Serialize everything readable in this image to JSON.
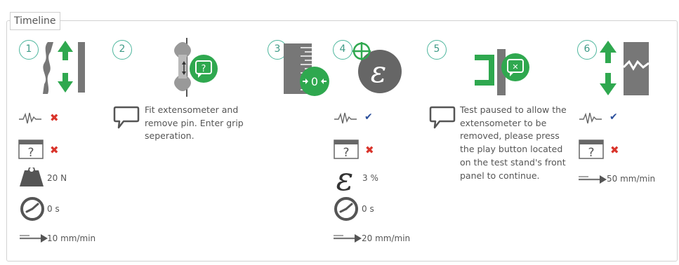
{
  "legend": "Timeline",
  "icons": {
    "data_capture": "waveform-icon",
    "prompt": "calendar-question-icon",
    "load": "weight-icon",
    "time": "clock-icon",
    "speed": "speed-arrow-icon",
    "strain": "epsilon-icon",
    "note": "speech-bubble-icon"
  },
  "colors": {
    "accent": "#2fa84f",
    "number": "#4fb79e",
    "cross": "#d9342b",
    "check": "#2b4f9c",
    "icon": "#777777"
  },
  "steps": [
    {
      "number": "1",
      "load": "20 N",
      "time": "0 s",
      "speed": "10 mm/min"
    },
    {
      "number": "2",
      "note": "Fit extensometer and remove pin. Enter grip seperation."
    },
    {
      "number": "3"
    },
    {
      "number": "4",
      "strain": "3 %",
      "time": "0 s",
      "speed": "20 mm/min"
    },
    {
      "number": "5",
      "note": "Test paused to allow the extensometer to be removed, please press the play button located on the test stand's front panel to continue."
    },
    {
      "number": "6",
      "speed": "50 mm/min"
    }
  ]
}
